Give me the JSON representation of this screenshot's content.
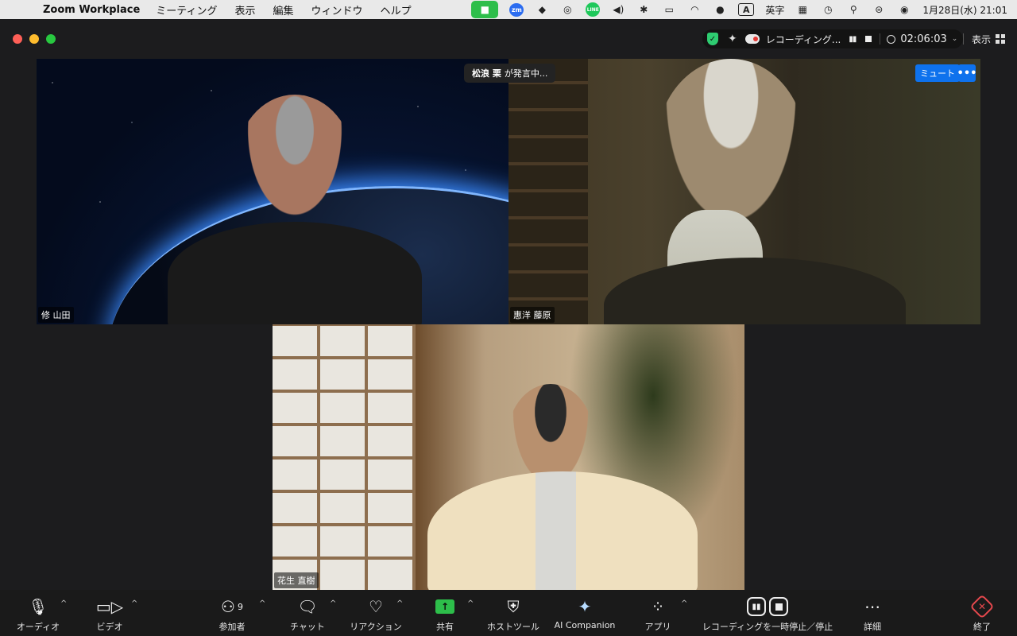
{
  "menubar": {
    "app_name": "Zoom Workplace",
    "menus": [
      "ミーティング",
      "表示",
      "編集",
      "ウィンドウ",
      "ヘルプ"
    ],
    "input_mode": "英字",
    "input_badge": "A",
    "zm_badge": "zm",
    "line_badge": "LINE",
    "datetime": "1月28日(水)  21:01"
  },
  "window": {
    "recording_label": "レコーディング...",
    "elapsed": "02:06:03",
    "view_label": "表示",
    "speaking": {
      "name": "松浪 栗",
      "suffix": "が発言中..."
    },
    "mute_label": "ミュート",
    "more_label": "•••"
  },
  "participants": [
    {
      "name": "修 山田"
    },
    {
      "name": "惠洋 藤原"
    },
    {
      "name": "花生 直樹"
    }
  ],
  "toolbar": {
    "audio": "オーディオ",
    "video": "ビデオ",
    "participants": "参加者",
    "participant_count": "9",
    "chat": "チャット",
    "reactions": "リアクション",
    "share": "共有",
    "host_tools": "ホストツール",
    "ai_companion": "AI Companion",
    "apps": "アプリ",
    "recording": "レコーディングを一時停止／停止",
    "more": "詳細",
    "end": "終了"
  },
  "colors": {
    "accent_blue": "#0e72ed",
    "share_green": "#2dbe4a",
    "end_red": "#e5484d"
  }
}
